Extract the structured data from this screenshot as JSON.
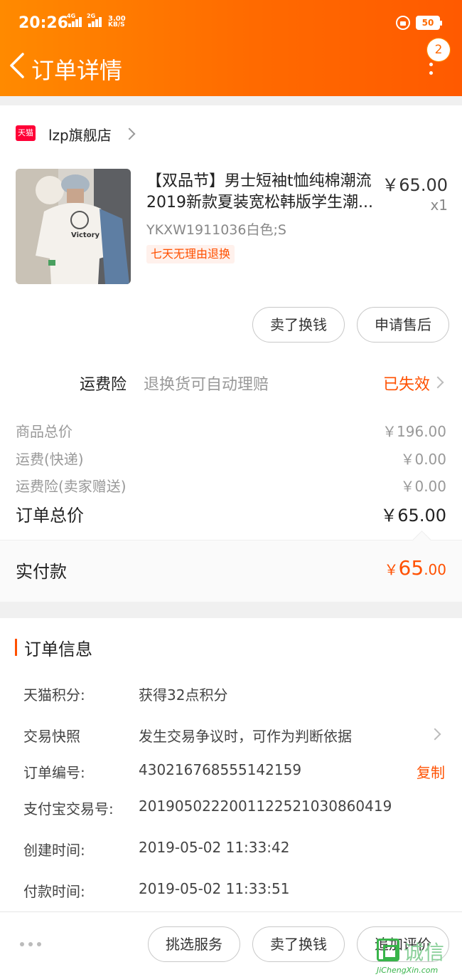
{
  "status_bar": {
    "time": "20:26",
    "signal_1": "4G",
    "signal_2": "2G",
    "speed_value": "3.00",
    "speed_unit": "KB/S",
    "battery": "50"
  },
  "header": {
    "title": "订单详情",
    "notification_count": "2",
    "accent_color": "#ff6a00"
  },
  "shop": {
    "badge": "天猫",
    "name": "lzp旗舰店"
  },
  "product": {
    "title": "【双品节】男士短袖t恤纯棉潮流2019新款夏装宽松韩版学生潮...",
    "price": "￥65.00",
    "quantity": "x1",
    "sku": "YKXW1911036白色;S",
    "tag": "七天无理由退换",
    "image_text": "Victory"
  },
  "item_actions": {
    "sell": "卖了换钱",
    "after_sale": "申请售后"
  },
  "shipping_insurance": {
    "label": "运费险",
    "description": "退换货可自动理赔",
    "status": "已失效"
  },
  "fees": {
    "goods_total_label": "商品总价",
    "goods_total_value": "￥196.00",
    "shipping_label": "运费(快递)",
    "shipping_value": "￥0.00",
    "insurance_label": "运费险(卖家赠送)",
    "insurance_value": "￥0.00",
    "order_total_label": "订单总价",
    "order_total_value": "￥65.00"
  },
  "payment": {
    "label": "实付款",
    "currency": "￥",
    "integer": "65",
    "decimal": ".00"
  },
  "order_info": {
    "title": "订单信息",
    "points_label": "天猫积分:",
    "points_value": "获得32点积分",
    "snapshot_label": "交易快照",
    "snapshot_value": "发生交易争议时，可作为判断依据",
    "order_no_label": "订单编号:",
    "order_no_value": "430216768555142159",
    "copy_label": "复制",
    "alipay_no_label": "支付宝交易号:",
    "alipay_no_value": "2019050222001122521030860419",
    "created_label": "创建时间:",
    "created_value": "2019-05-02 11:33:42",
    "paid_label": "付款时间:",
    "paid_value": "2019-05-02 11:33:51"
  },
  "bottom_actions": {
    "select_service": "挑选服务",
    "sell": "卖了换钱",
    "review": "追加评价"
  },
  "watermark": {
    "chinese": "诚信",
    "domain": "JiChengXin.com"
  }
}
